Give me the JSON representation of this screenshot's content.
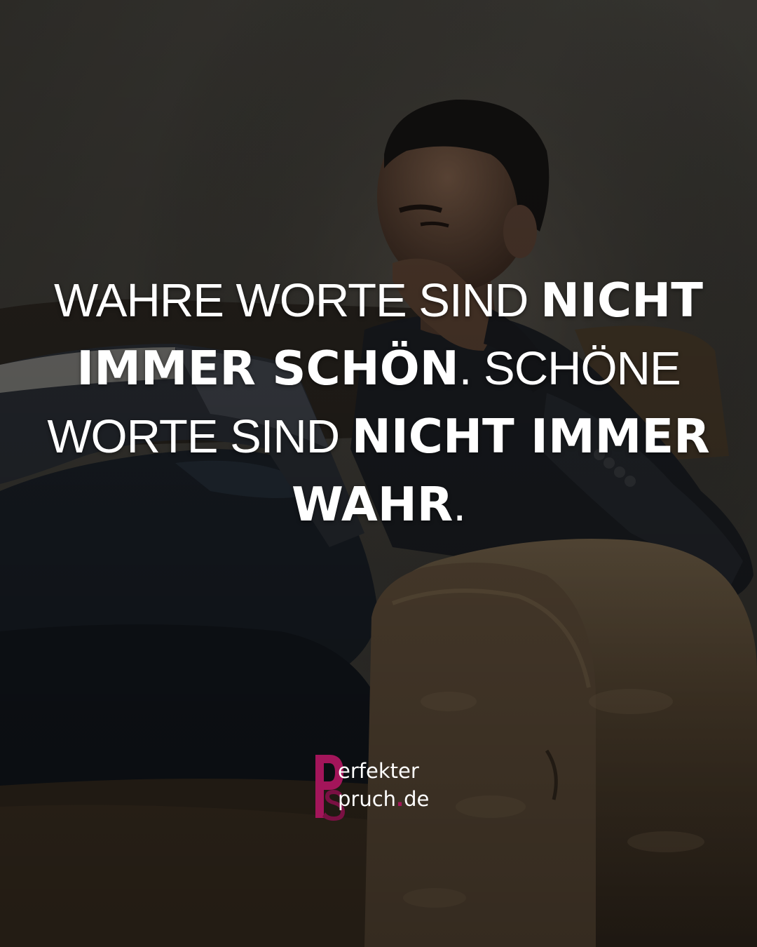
{
  "image": {
    "scene_description_icon": "man-reading-on-armchair-photo",
    "overlay_color": "#000000"
  },
  "quote": {
    "segments": [
      {
        "text": "Wahre Worte sind ",
        "weight": "light"
      },
      {
        "text": "nicht immer schön",
        "weight": "bold"
      },
      {
        "text": ". Schöne Worte sind ",
        "weight": "light"
      },
      {
        "text": "nicht immer wahr",
        "weight": "bold"
      },
      {
        "text": ".",
        "weight": "light"
      }
    ]
  },
  "logo": {
    "line1": "erfekter",
    "line2_main": "pruch",
    "line2_dot": ".",
    "line2_tld": "de",
    "letters": "PS",
    "accent_color": "#a3155a"
  }
}
